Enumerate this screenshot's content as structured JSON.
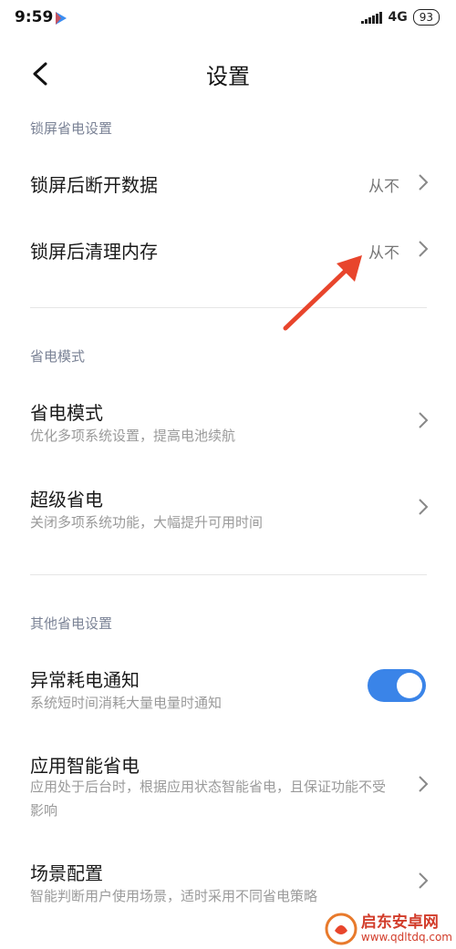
{
  "status_bar": {
    "time": "9:59",
    "network": "4G",
    "battery": "93"
  },
  "header": {
    "title": "设置"
  },
  "sections": [
    {
      "label": "锁屏省电设置"
    },
    {
      "label": "省电模式"
    },
    {
      "label": "其他省电设置"
    }
  ],
  "items": [
    {
      "title": "锁屏后断开数据",
      "value": "从不"
    },
    {
      "title": "锁屏后清理内存",
      "value": "从不"
    },
    {
      "title": "省电模式",
      "subtitle": "优化多项系统设置，提高电池续航"
    },
    {
      "title": "超级省电",
      "subtitle": "关闭多项系统功能，大幅提升可用时间"
    },
    {
      "title": "异常耗电通知",
      "subtitle": "系统短时间消耗大量电量时通知",
      "toggle_on": true
    },
    {
      "title": "应用智能省电",
      "subtitle": "应用处于后台时，根据应用状态智能省电，且保证功能不受影响"
    },
    {
      "title": "场景配置",
      "subtitle": "智能判断用户使用场景，适时采用不同省电策略"
    }
  ],
  "watermark": {
    "name": "启东安卓网",
    "url": "www.qdltdq.com"
  },
  "colors": {
    "accent": "#3a84e8",
    "annotation_arrow": "#e8452c"
  }
}
